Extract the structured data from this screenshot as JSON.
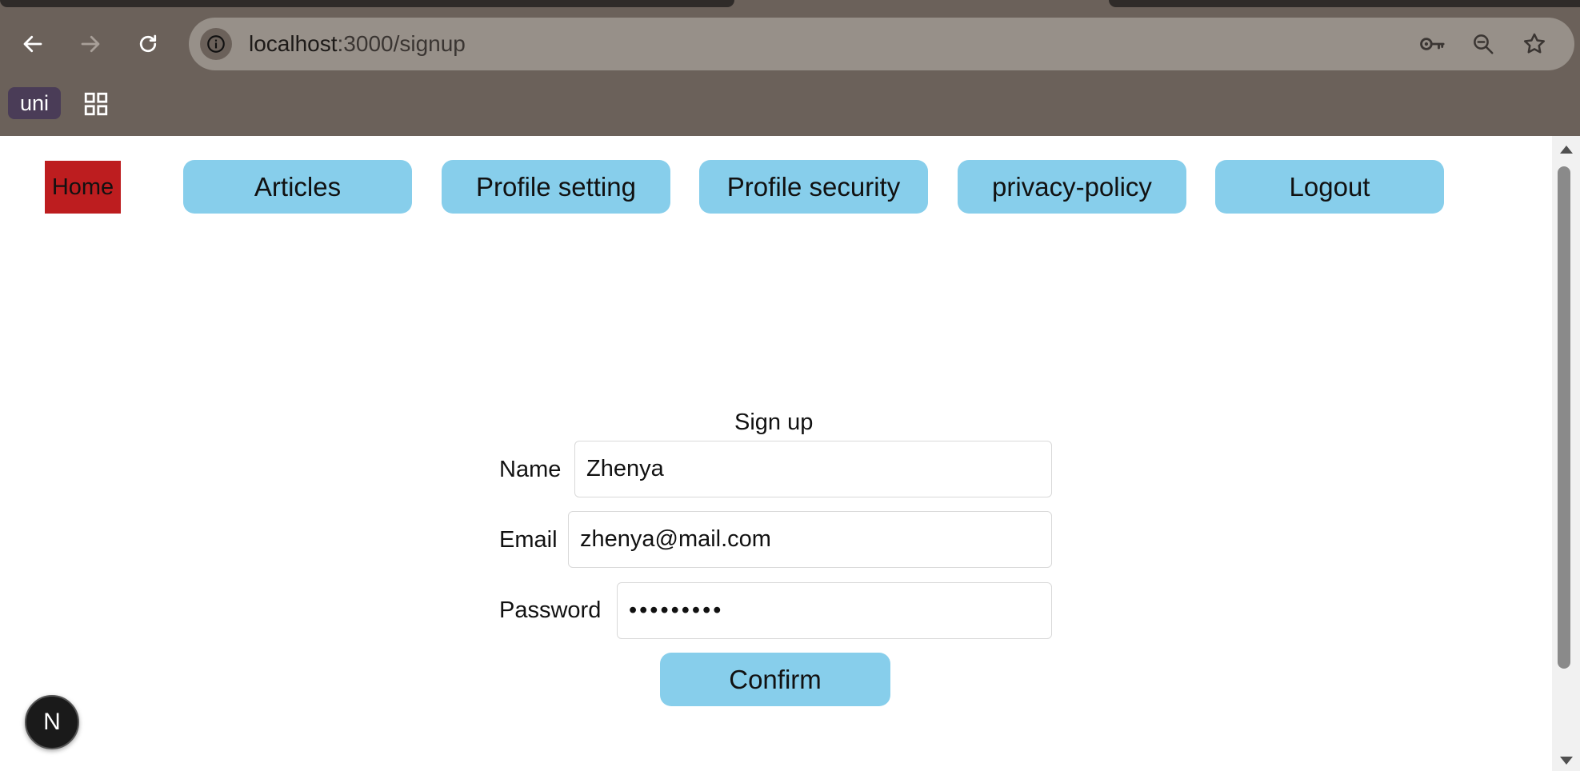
{
  "browser": {
    "url_host": "localhost",
    "url_rest": ":3000/signup",
    "bookmarks": {
      "uni_label": "uni"
    },
    "icons": {
      "back": "arrow-left-icon",
      "forward": "arrow-right-icon",
      "reload": "reload-icon",
      "site_info": "info-icon",
      "password": "key-icon",
      "zoom": "zoom-icon",
      "bookmark": "star-icon",
      "apps": "apps-grid-icon"
    }
  },
  "nav": {
    "home": "Home",
    "articles": "Articles",
    "profile_setting": "Profile setting",
    "profile_security": "Profile security",
    "privacy_policy": "privacy-policy",
    "logout": "Logout"
  },
  "form": {
    "title": "Sign up",
    "name_label": "Name",
    "name_value": "Zhenya",
    "email_label": "Email",
    "email_value": "zhenya@mail.com",
    "password_label": "Password",
    "password_value": "123456789",
    "confirm_label": "Confirm"
  },
  "dev_badge": {
    "label": "N"
  },
  "colors": {
    "nav_button": "#87ceeb",
    "home_button": "#bd1d1f",
    "chrome": "#6b615a",
    "omnibox": "#979089"
  }
}
